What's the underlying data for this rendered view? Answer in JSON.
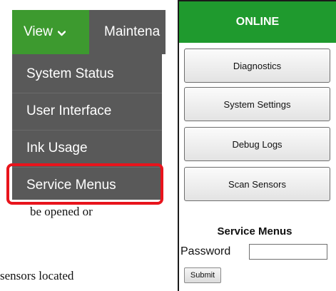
{
  "menu": {
    "view_label": "View",
    "maintenance_label": "Maintena",
    "dropdown_items": [
      "System Status",
      "User Interface",
      "Ink Usage",
      "Service Menus"
    ],
    "highlight_color": "#e8141c",
    "view_color": "#3d9a2f",
    "menu_color": "#595959"
  },
  "document": {
    "line1": "be opened or",
    "line2": "sensors located"
  },
  "panel": {
    "status": "ONLINE",
    "status_color": "#1f9a2e",
    "buttons": [
      "Diagnostics",
      "System Settings",
      "Debug Logs",
      "Scan Sensors"
    ],
    "service_title": "Service Menus",
    "password_label": "Password",
    "password_value": "",
    "submit_label": "Submit"
  }
}
